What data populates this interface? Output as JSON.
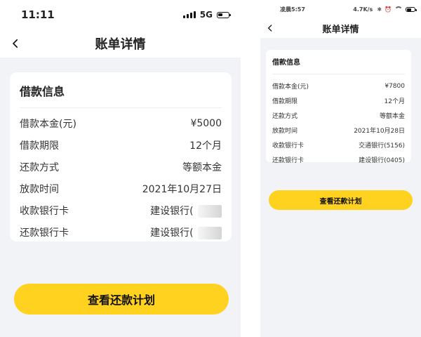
{
  "left": {
    "status": {
      "time": "11:11",
      "network": "5G",
      "icons": [
        "signal-icon",
        "battery-icon"
      ]
    },
    "nav": {
      "title": "账单详情",
      "back_icon": "back-chevron-icon"
    },
    "card": {
      "title": "借款信息",
      "rows": [
        {
          "label": "借款本金(元)",
          "value": "¥5000"
        },
        {
          "label": "借款期限",
          "value": "12个月"
        },
        {
          "label": "还款方式",
          "value": "等额本金"
        },
        {
          "label": "放款时间",
          "value": "2021年10月27日"
        },
        {
          "label": "收款银行卡",
          "value": "建设银行("
        },
        {
          "label": "还款银行卡",
          "value": "建设银行("
        }
      ]
    },
    "cta": {
      "label": "查看还款计划"
    }
  },
  "right": {
    "status": {
      "time": "凌晨5:57",
      "network": "4.7K/s",
      "icons": [
        "notification-icon",
        "bluetooth-icon",
        "alarm-icon",
        "wifi-icon",
        "battery-icon"
      ]
    },
    "nav": {
      "title": "账单详情",
      "back_icon": "back-chevron-icon"
    },
    "card": {
      "title": "借款信息",
      "rows": [
        {
          "label": "借款本金(元)",
          "value": "¥7800"
        },
        {
          "label": "借款期限",
          "value": "12个月"
        },
        {
          "label": "还款方式",
          "value": "等额本金"
        },
        {
          "label": "放款时间",
          "value": "2021年10月28日"
        },
        {
          "label": "收款银行卡",
          "value": "交通银行(5156)"
        },
        {
          "label": "还款银行卡",
          "value": "建设银行(0405)"
        }
      ]
    },
    "cta": {
      "label": "查看还款计划"
    }
  },
  "colors": {
    "accent": "#ffd21f",
    "page_bg": "#f2f3f7",
    "text": "#222222"
  }
}
